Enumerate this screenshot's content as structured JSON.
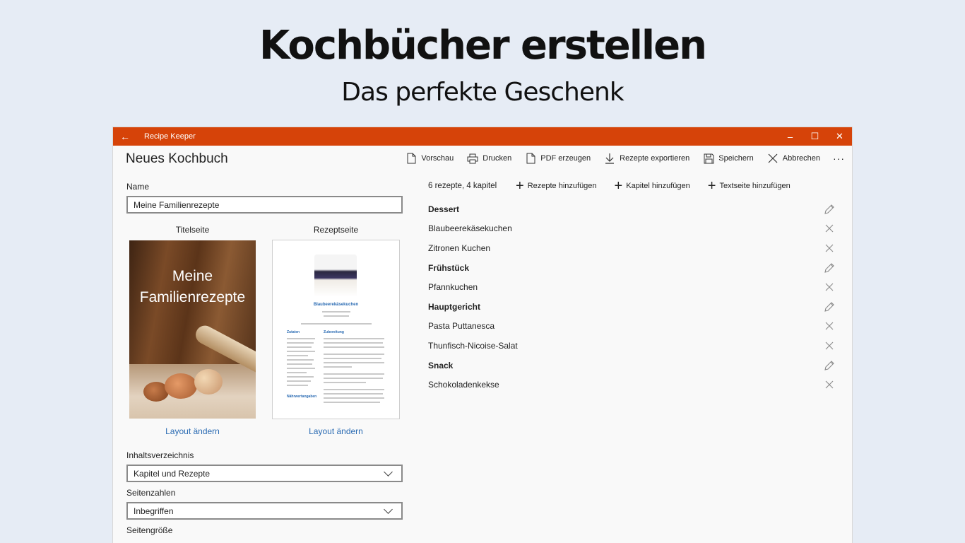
{
  "promo": {
    "title": "Kochbücher erstellen",
    "subtitle": "Das perfekte Geschenk"
  },
  "window": {
    "app_name": "Recipe Keeper",
    "back_glyph": "←",
    "minimize_glyph": "–",
    "maximize_glyph": "☐",
    "close_glyph": "✕",
    "accent_color": "#d64309"
  },
  "page_title": "Neues Kochbuch",
  "commands": [
    {
      "label": "Vorschau",
      "icon": "document-icon"
    },
    {
      "label": "Drucken",
      "icon": "printer-icon"
    },
    {
      "label": "PDF erzeugen",
      "icon": "pdf-icon"
    },
    {
      "label": "Rezepte exportieren",
      "icon": "download-icon"
    },
    {
      "label": "Speichern",
      "icon": "save-icon"
    },
    {
      "label": "Abbrechen",
      "icon": "close-icon"
    }
  ],
  "more_glyph": "···",
  "form": {
    "name_label": "Name",
    "name_value": "Meine Familienrezepte",
    "title_page_label": "Titelseite",
    "recipe_page_label": "Rezeptseite",
    "cover_text_line1": "Meine",
    "cover_text_line2": "Familienrezepte",
    "recipe_preview_title": "Blaubeerekäsekuchen",
    "recipe_preview_ingredients": "Zutaten",
    "recipe_preview_preparation": "Zubereitung",
    "recipe_preview_nutrition": "Nährwertangaben",
    "change_layout_left": "Layout ändern",
    "change_layout_right": "Layout ändern",
    "toc_label": "Inhaltsverzeichnis",
    "toc_value": "Kapitel und Rezepte",
    "page_numbers_label": "Seitenzahlen",
    "page_numbers_value": "Inbegriffen",
    "page_size_label": "Seitengröße"
  },
  "summary": "6 rezepte, 4 kapitel",
  "add_actions": [
    {
      "label": "Rezepte hinzufügen"
    },
    {
      "label": "Kapitel hinzufügen"
    },
    {
      "label": "Textseite hinzufügen"
    }
  ],
  "plus_glyph": "+",
  "contents": [
    {
      "type": "chapter",
      "label": "Dessert"
    },
    {
      "type": "recipe",
      "label": "Blaubeerekäsekuchen"
    },
    {
      "type": "recipe",
      "label": "Zitronen Kuchen"
    },
    {
      "type": "chapter",
      "label": "Frühstück"
    },
    {
      "type": "recipe",
      "label": "Pfannkuchen"
    },
    {
      "type": "chapter",
      "label": "Hauptgericht"
    },
    {
      "type": "recipe",
      "label": "Pasta Puttanesca"
    },
    {
      "type": "recipe",
      "label": "Thunfisch-Nicoise-Salat"
    },
    {
      "type": "chapter",
      "label": "Snack"
    },
    {
      "type": "recipe",
      "label": "Schokoladenkekse"
    }
  ]
}
